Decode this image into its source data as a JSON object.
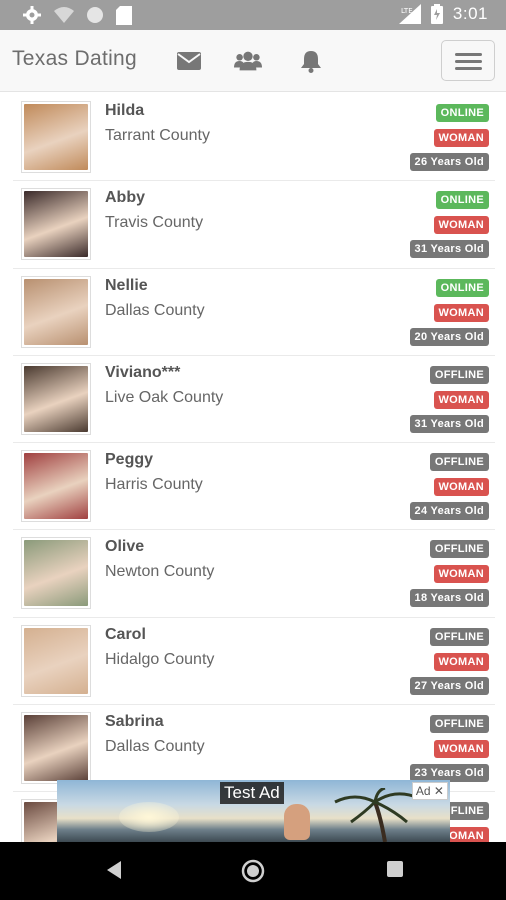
{
  "status_bar": {
    "time": "3:01",
    "icons_left": [
      "gear-icon",
      "wifi-icon",
      "circle-icon",
      "sd-card-icon"
    ],
    "icons_right": [
      "lte-signal-icon",
      "battery-icon"
    ]
  },
  "navbar": {
    "brand": "Texas Dating",
    "icons": [
      "mail-icon",
      "users-icon",
      "bell-icon"
    ],
    "menu": "hamburger-menu-icon"
  },
  "colors": {
    "online": "#5cb85c",
    "offline": "#777777",
    "woman": "#d9534f",
    "age": "#777777",
    "status_bar": "#9e9e9e"
  },
  "profiles": [
    {
      "name": "Hilda",
      "county": "Tarrant County",
      "status": "ONLINE",
      "gender": "WOMAN",
      "age": "26 Years Old",
      "avatar": "#c08a5a"
    },
    {
      "name": "Abby",
      "county": "Travis County",
      "status": "ONLINE",
      "gender": "WOMAN",
      "age": "31 Years Old",
      "avatar": "#3a2a2a"
    },
    {
      "name": "Nellie",
      "county": "Dallas County",
      "status": "ONLINE",
      "gender": "WOMAN",
      "age": "20 Years Old",
      "avatar": "#b89070"
    },
    {
      "name": "Viviano***",
      "county": "Live Oak County",
      "status": "OFFLINE",
      "gender": "WOMAN",
      "age": "31 Years Old",
      "avatar": "#4a3a30"
    },
    {
      "name": "Peggy",
      "county": "Harris County",
      "status": "OFFLINE",
      "gender": "WOMAN",
      "age": "24 Years Old",
      "avatar": "#a04040"
    },
    {
      "name": "Olive",
      "county": "Newton County",
      "status": "OFFLINE",
      "gender": "WOMAN",
      "age": "18 Years Old",
      "avatar": "#8a9a7a"
    },
    {
      "name": "Carol",
      "county": "Hidalgo County",
      "status": "OFFLINE",
      "gender": "WOMAN",
      "age": "27 Years Old",
      "avatar": "#d4b090"
    },
    {
      "name": "Sabrina",
      "county": "Dallas County",
      "status": "OFFLINE",
      "gender": "WOMAN",
      "age": "23 Years Old",
      "avatar": "#5a4038"
    },
    {
      "name": "",
      "county": "",
      "status": "OFFLINE",
      "gender": "WOMAN",
      "age": "",
      "avatar": "#6a4a40"
    }
  ],
  "ad": {
    "label": "Test Ad",
    "badge": "Ad ✕"
  },
  "system_nav": [
    "back-icon",
    "home-icon",
    "recents-icon"
  ]
}
